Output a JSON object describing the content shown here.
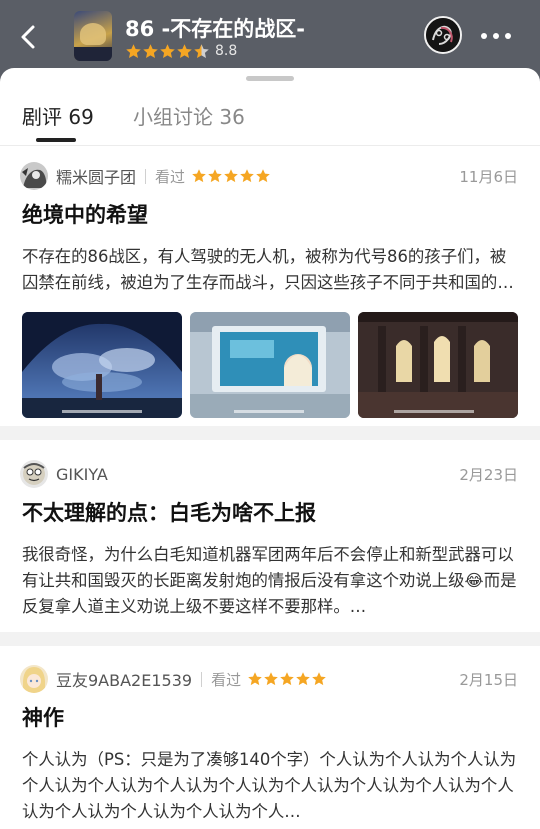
{
  "header": {
    "back_icon": "chevron-left-icon",
    "title": "86 -不存在的战区-",
    "rating_stars": 4.5,
    "score": "8.8",
    "more_icon": "more-dots-icon"
  },
  "tabs": [
    {
      "label": "剧评 69",
      "active": true
    },
    {
      "label": "小组讨论 36",
      "active": false
    }
  ],
  "colors": {
    "header_bg": "#5a5e66",
    "star": "#f5a623",
    "text_primary": "#111111",
    "text_secondary": "#999999"
  },
  "reviews": [
    {
      "user": "糯米圆子团",
      "status": "看过",
      "stars": 5,
      "date": "11月6日",
      "title": "绝境中的希望",
      "body": "不存在的86战区，有人驾驶的无人机，被称为代号86的孩子们，被囚禁在前线，被迫为了生存而战斗，只因这些孩子不同于共和国的白系种，就被视为非人…",
      "images": [
        "sky-clouds-scene",
        "palace-screen-scene",
        "church-interior-scene"
      ]
    },
    {
      "user": "GIKIYA",
      "status": "",
      "stars": 0,
      "date": "2月23日",
      "title": "不太理解的点：白毛为啥不上报",
      "body": "我很奇怪，为什么白毛知道机器军团两年后不会停止和新型武器可以有让共和国毁灭的长距离发射炮的情报后没有拿这个劝说上级😂而是反复拿人道主义劝说上级不要这样不要那样。…"
    },
    {
      "user": "豆友9ABA2E1539",
      "status": "看过",
      "stars": 5,
      "date": "2月15日",
      "title": "神作",
      "body": "个人认为（PS：只是为了凑够140个字）个人认为个人认为个人认为个人认为个人认为个人认为个人认为个人认为个人认为个人认为个人认为个人认为个人认为个人认为个人…"
    }
  ]
}
